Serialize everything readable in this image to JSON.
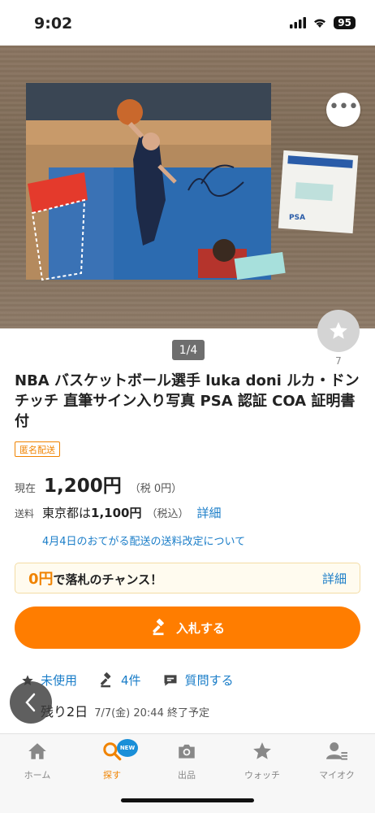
{
  "status_bar": {
    "time": "9:02",
    "battery": "95"
  },
  "image": {
    "counter": "1/4",
    "watch_count": "7",
    "signature": "luka"
  },
  "item": {
    "title": "NBA バスケットボール選手 luka doni ルカ・ドンチッチ 直筆サイン入り写真 PSA 認証 COA 証明書付",
    "badge": "匿名配送"
  },
  "price": {
    "label": "現在",
    "value": "1,200円",
    "tax": "（税 0円）"
  },
  "shipping": {
    "label": "送料",
    "prefix": "東京都は",
    "amount": "1,100円",
    "tax": "（税込）",
    "detail_link": "詳細",
    "notice": "4月4日のおてがる配送の送料改定について"
  },
  "chance": {
    "zero": "0円",
    "text": "で落札のチャンス！",
    "detail_link": "詳細"
  },
  "bid_button": {
    "label": "入札する"
  },
  "meta": {
    "condition": "未使用",
    "bids": "4件",
    "question": "質問する"
  },
  "end": {
    "remaining": "残り2日",
    "datetime": "7/7(金) 20:44 終了予定"
  },
  "tabs": [
    {
      "label": "ホーム",
      "icon": "home-icon"
    },
    {
      "label": "探す",
      "icon": "search-icon",
      "badge": "NEW"
    },
    {
      "label": "出品",
      "icon": "camera-icon"
    },
    {
      "label": "ウォッチ",
      "icon": "star-icon"
    },
    {
      "label": "マイオク",
      "icon": "my-account-icon"
    }
  ],
  "colors": {
    "accent": "#ff7d00",
    "link": "#1a7dc8",
    "badge_blue": "#1a8fd8"
  }
}
